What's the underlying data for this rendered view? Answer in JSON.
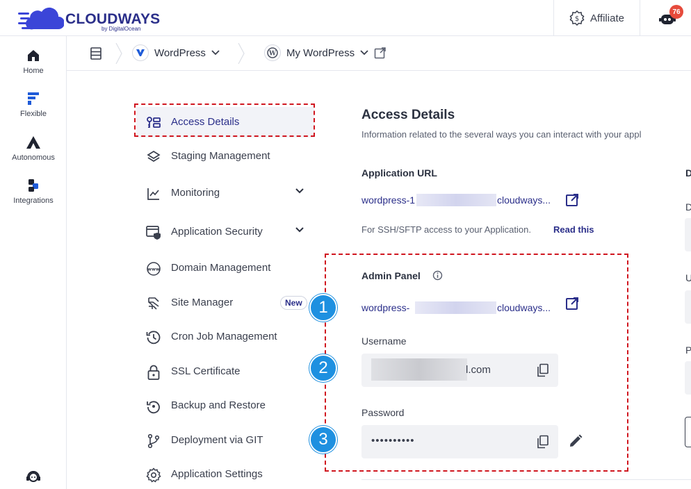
{
  "brand": {
    "name": "CLOUDWAYS",
    "byline": "by DigitalOcean"
  },
  "topbar": {
    "affiliate_label": "Affiliate",
    "notification_count": "76"
  },
  "leftnav": {
    "items": [
      {
        "label": "Home",
        "icon": "home-icon"
      },
      {
        "label": "Flexible",
        "icon": "flexible-icon"
      },
      {
        "label": "Autonomous",
        "icon": "autonomous-icon"
      },
      {
        "label": "Integrations",
        "icon": "integrations-icon"
      }
    ]
  },
  "breadcrumb": {
    "server": "WordPress",
    "application": "My WordPress"
  },
  "menu": {
    "items": [
      {
        "label": "Access Details"
      },
      {
        "label": "Staging Management"
      },
      {
        "label": "Monitoring"
      },
      {
        "label": "Application Security"
      },
      {
        "label": "Domain Management"
      },
      {
        "label": "Site Manager"
      },
      {
        "label": "Cron Job Management"
      },
      {
        "label": "SSL Certificate"
      },
      {
        "label": "Backup and Restore"
      },
      {
        "label": "Deployment via GIT"
      },
      {
        "label": "Application Settings"
      }
    ],
    "new_badge": "New"
  },
  "content": {
    "title": "Access Details",
    "description": "Information related to the several ways you can interact with your appl",
    "app_url_label": "Application URL",
    "app_url_prefix": "wordpress-1",
    "app_url_suffix": "cloudways...",
    "ssh_hint": "For SSH/SFTP access to your Application.",
    "read_this": "Read this",
    "admin_panel_label": "Admin Panel",
    "admin_url_prefix": "wordpress-",
    "admin_url_suffix": "cloudways...",
    "username_label": "Username",
    "username_value_suffix": "l.com",
    "password_label": "Password",
    "password_value": "••••••••••",
    "steps": [
      "1",
      "2",
      "3"
    ]
  },
  "right_column": {
    "header_initial": "D",
    "labels": [
      "D",
      "U",
      "P"
    ]
  },
  "colors": {
    "brand": "#2b2f8a",
    "highlight": "#d0161f",
    "step": "#1e90e0"
  }
}
